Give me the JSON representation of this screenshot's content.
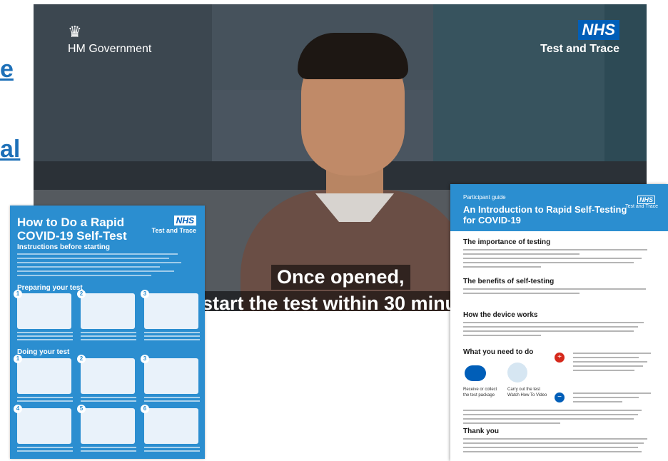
{
  "side_links": {
    "link1": "e",
    "link2": "al"
  },
  "video": {
    "gov_label": "HM Government",
    "nhs_badge": "NHS",
    "nhs_label": "Test and Trace",
    "subtitle_line1": "Once opened,",
    "subtitle_line2": "start the test within 30 minu"
  },
  "poster": {
    "title": "How to Do a Rapid COVID-19 Self-Test",
    "nhs_badge": "NHS",
    "nhs_label": "Test and Trace",
    "section1": "Instructions before starting",
    "section2": "Preparing your test",
    "section3": "Doing your test",
    "step_numbers": [
      "1",
      "2",
      "3",
      "1",
      "2",
      "3",
      "4",
      "5",
      "6"
    ]
  },
  "document": {
    "pre_title": "Participant guide",
    "title": "An Introduction to Rapid Self-Testing for COVID-19",
    "nhs_badge": "NHS",
    "nhs_label": "Test and Trace",
    "heading1": "The importance of testing",
    "heading2": "The benefits of self-testing",
    "heading3": "How the device works",
    "heading4": "What you need to do",
    "heading5": "Thank you",
    "need_step1": "Receive or collect the test package",
    "need_step2": "Carry out the test Watch How To Video"
  }
}
